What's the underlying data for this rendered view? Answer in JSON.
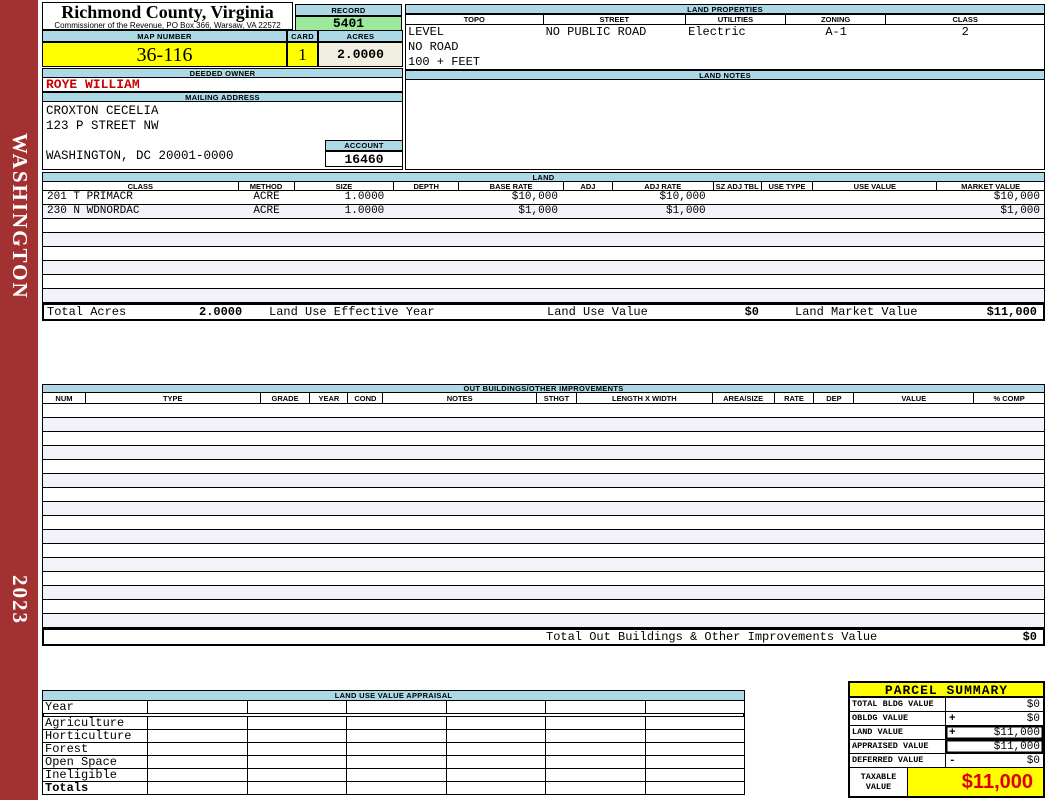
{
  "sidebar": {
    "county": "WASHINGTON",
    "year": "2023"
  },
  "header": {
    "title": "Richmond County, Virginia",
    "subtitle": "Commissioner of the Revenue, PO Box 366, Warsaw, VA 22572",
    "record_label": "RECORD",
    "record_value": "5401",
    "map_number_label": "MAP NUMBER",
    "map_number_value": "36-116",
    "card_label": "CARD",
    "card_value": "1",
    "acres_label": "ACRES",
    "acres_value": "2.0000"
  },
  "land_properties": {
    "title": "LAND PROPERTIES",
    "columns": [
      "TOPO",
      "STREET",
      "UTILITIES",
      "ZONING",
      "CLASS"
    ],
    "values": {
      "topo": [
        "LEVEL",
        "NO ROAD",
        "100 + FEET"
      ],
      "street": "NO PUBLIC ROAD",
      "utilities": "Electric",
      "zoning": "A-1",
      "class": "2"
    }
  },
  "land_notes": {
    "title": "LAND NOTES"
  },
  "owner": {
    "deeded_owner_label": "DEEDED OWNER",
    "deeded_owner": "ROYE WILLIAM",
    "mailing_address_label": "MAILING ADDRESS",
    "address_lines": [
      "CROXTON CECELIA",
      "123 P STREET NW",
      "",
      "WASHINGTON, DC 20001-0000"
    ],
    "account_label": "ACCOUNT",
    "account_value": "16460"
  },
  "land_table": {
    "title": "LAND",
    "columns": [
      "CLASS",
      "METHOD",
      "SIZE",
      "DEPTH",
      "BASE RATE",
      "ADJ",
      "ADJ RATE",
      "SZ ADJ TBL",
      "USE TYPE",
      "USE VALUE",
      "MARKET VALUE"
    ],
    "rows": [
      [
        "201 T PRIMACR",
        "ACRE",
        "1.0000",
        "",
        "$10,000",
        "",
        "$10,000",
        "",
        "",
        "",
        "$10,000"
      ],
      [
        "230 N WDNORDAC",
        "ACRE",
        "1.0000",
        "",
        "$1,000",
        "",
        "$1,000",
        "",
        "",
        "",
        "$1,000"
      ]
    ],
    "blank_row_count": 6,
    "totals": {
      "total_acres_label": "Total Acres",
      "total_acres": "2.0000",
      "land_use_effective_year_label": "Land Use Effective Year",
      "land_use_value_label": "Land Use Value",
      "land_use_value": "$0",
      "land_market_value_label": "Land Market Value",
      "land_market_value": "$11,000"
    }
  },
  "out_buildings": {
    "title": "OUT BUILDINGS/OTHER IMPROVEMENTS",
    "columns": [
      "NUM",
      "TYPE",
      "GRADE",
      "YEAR",
      "COND",
      "NOTES",
      "STHGT",
      "LENGTH X WIDTH",
      "AREA/SIZE",
      "RATE",
      "DEP",
      "VALUE",
      "% COMP"
    ],
    "blank_row_count": 16,
    "total_label": "Total Out Buildings & Other Improvements Value",
    "total_value": "$0"
  },
  "land_use_appraisal": {
    "title": "LAND USE VALUE APPRAISAL",
    "row_labels": [
      "Year",
      "Agriculture",
      "Horticulture",
      "Forest",
      "Open Space",
      "Ineligible",
      "Totals"
    ],
    "column_count": 6
  },
  "parcel_summary": {
    "title": "PARCEL SUMMARY",
    "rows": [
      {
        "label": "TOTAL BLDG VALUE",
        "op": "",
        "value": "$0"
      },
      {
        "label": "OBLDG VALUE",
        "op": "+",
        "value": "$0"
      },
      {
        "label": "LAND VALUE",
        "op": "+",
        "value": "$11,000"
      },
      {
        "label": "APPRAISED VALUE",
        "op": "",
        "value": "$11,000"
      },
      {
        "label": "DEFERRED VALUE",
        "op": "-",
        "value": "$0"
      }
    ],
    "taxable_label": "TAXABLE VALUE",
    "taxable_value": "$11,000"
  },
  "colors": {
    "sidebar_red": "#A23232",
    "header_blue": "#ADD8E6",
    "record_green": "#9CE89C",
    "highlight_yellow": "#FFFF00",
    "acres_cream": "#F0EFE1",
    "owner_red": "#CC0000",
    "taxable_red": "#E10000"
  }
}
